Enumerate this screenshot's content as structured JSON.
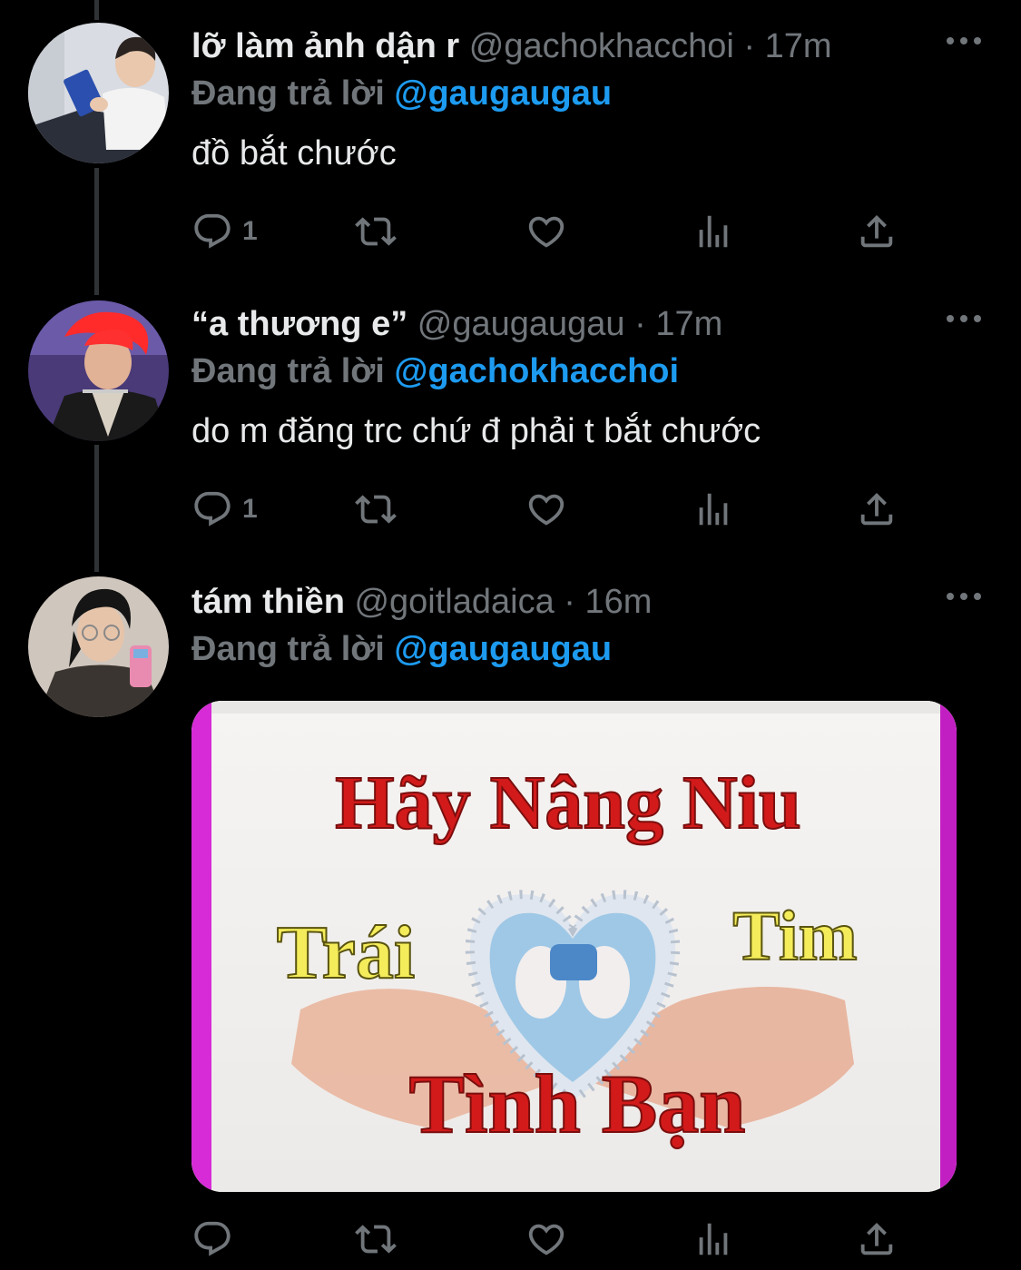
{
  "tweets": [
    {
      "name": "lỡ làm ảnh dận r",
      "handle": "@gachokhacchoi",
      "separator": "·",
      "time": "17m",
      "reply_prefix": "Đang trả lời",
      "reply_to": "@gaugaugau",
      "text": "đồ bắt chước",
      "reply_count": "1"
    },
    {
      "name": "“a thương e”",
      "handle": "@gaugaugau",
      "separator": "·",
      "time": "17m",
      "reply_prefix": "Đang trả lời",
      "reply_to": "@gachokhacchoi",
      "text": "do m đăng trc chứ đ phải t bắt chước",
      "reply_count": "1"
    },
    {
      "name": "tám thiền",
      "handle": "@goitladaica",
      "separator": "·",
      "time": "16m",
      "reply_prefix": "Đang trả lời",
      "reply_to": "@gaugaugau",
      "media_text": {
        "line1": "Hãy Nâng Niu",
        "left": "Trái",
        "right": "Tim",
        "line3": "Tình Bạn"
      }
    }
  ],
  "icons": [
    "reply-icon",
    "retweet-icon",
    "like-icon",
    "views-icon",
    "share-icon",
    "more-icon"
  ],
  "colors": {
    "background": "#000000",
    "text": "#e7e9ea",
    "muted": "#71767b",
    "mention": "#1d9bf0",
    "thread_line": "#2f3336"
  }
}
